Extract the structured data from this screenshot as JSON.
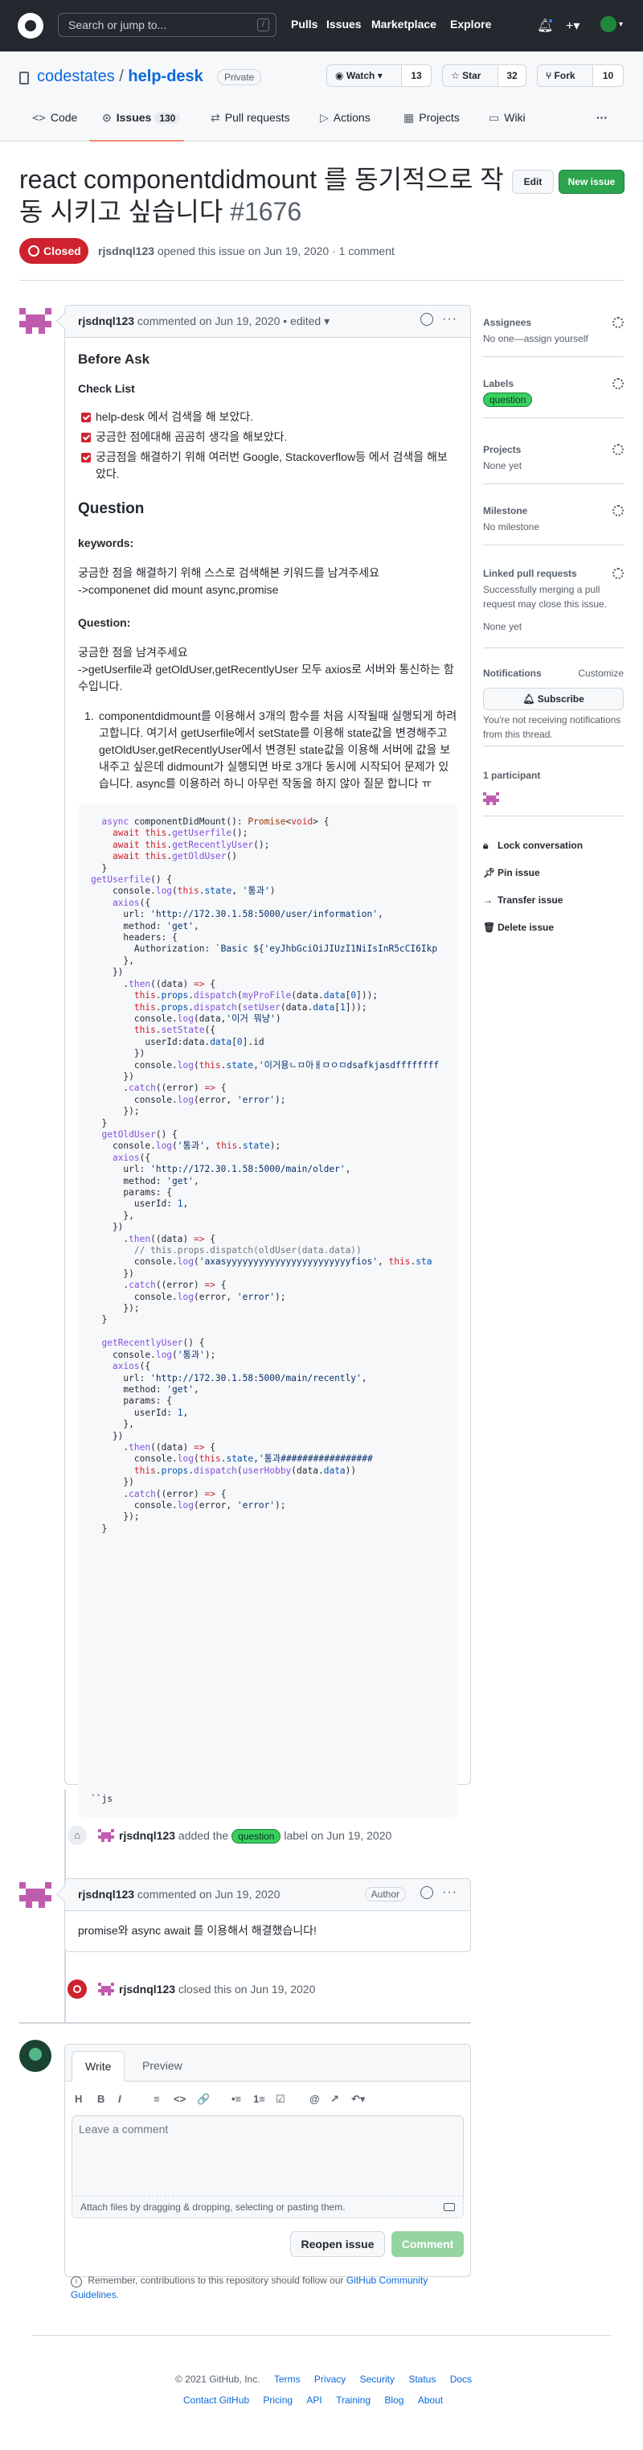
{
  "header": {
    "search_placeholder": "Search or jump to...",
    "search_key": "/",
    "nav": [
      "Pulls",
      "Issues",
      "Marketplace",
      "Explore"
    ]
  },
  "repo": {
    "owner": "codestates",
    "separator": "/",
    "name": "help-desk",
    "visibility": "Private",
    "watch_label": "Watch",
    "watch_count": "13",
    "star_label": "Star",
    "star_count": "32",
    "fork_label": "Fork",
    "fork_count": "10",
    "tabs": [
      {
        "label": "Code",
        "icon": "code-icon"
      },
      {
        "label": "Issues",
        "icon": "issue-opened-icon",
        "count": "130"
      },
      {
        "label": "Pull requests",
        "icon": "git-pull-request-icon"
      },
      {
        "label": "Actions",
        "icon": "play-icon"
      },
      {
        "label": "Projects",
        "icon": "table-icon"
      },
      {
        "label": "Wiki",
        "icon": "book-icon"
      }
    ],
    "more": "···"
  },
  "issue": {
    "title": "react componentdidmount 를 동기적으로 작동 시키고 싶습니다",
    "number": "#1676",
    "edit_label": "Edit",
    "new_issue_label": "New issue",
    "state": "Closed",
    "author": "rjsdnql123",
    "meta": "opened this issue on Jun 19, 2020 · 1 comment"
  },
  "first_comment": {
    "author": "rjsdnql123",
    "meta": "commented on Jun 19, 2020 • edited ▾",
    "before_ask": "Before Ask",
    "check_list": "Check List",
    "checks": [
      "help-desk 에서 검색을 해 보았다.",
      "궁금한 점에대해 곰곰히 생각을 해보았다.",
      "궁금점을 해결하기 위해 여러번 Google, Stackoverflow등 에서 검색을 해보았다."
    ],
    "question_heading": "Question",
    "keywords_label": "keywords:",
    "keywords_line1": "궁금한 점을 해결하기 위해 스스로 검색해본 키워드를 남겨주세요",
    "keywords_line2": "->componenet did mount async,promise",
    "question_label": "Question:",
    "question_line1": "궁금한 점을 남겨주세요",
    "question_line2": "->getUserfile과 getOldUser,getRecentlyUser 모두 axios로 서버와 통신하는 함수입니다.",
    "list_item": "componentdidmount를 이용해서 3개의 함수를 처음 시작될때 실행되게 하려고합니다. 여기서 getUserfile에서 setState를 이용해 state값을 변경해주고 getOldUser,getRecentlyUser에서 변경된 state값을 이용해 서버에 값을 보내주고 싶은데 didmount가 실행되면 바로 3개다 동시에 시작되어 문제가 있습니다. async를 이용하러 하니 아무런 작동을 하지 않아 질문 합니다 ㅠ",
    "code_tail": "``js"
  },
  "labeled_event": {
    "author": "rjsdnql123",
    "pre": "added the",
    "label": "question",
    "post": "label on Jun 19, 2020"
  },
  "second_comment": {
    "author": "rjsdnql123",
    "meta": "commented on Jun 19, 2020",
    "author_badge": "Author",
    "body": "promise와 async await 를 이용해서 해결했습니다!"
  },
  "closed_event": {
    "author": "rjsdnql123",
    "text": "closed this on Jun 19, 2020"
  },
  "composer": {
    "tab_write": "Write",
    "tab_preview": "Preview",
    "placeholder": "Leave a comment",
    "attach": "Attach files by dragging & dropping, selecting or pasting them.",
    "reopen": "Reopen issue",
    "comment": "Comment",
    "tools": [
      "H",
      "B",
      "I",
      "≡",
      "<>",
      "🔗",
      "•≡",
      "1≡",
      "☑",
      "@",
      "↗",
      "↶▾"
    ]
  },
  "remember": {
    "text": "Remember, contributions to this repository should follow our",
    "link": "GitHub Community Guidelines",
    "end": "."
  },
  "sidebar": {
    "assignees_heading": "Assignees",
    "assignees_value": "No one—assign yourself",
    "labels_heading": "Labels",
    "label": "question",
    "projects_heading": "Projects",
    "projects_value": "None yet",
    "milestone_heading": "Milestone",
    "milestone_value": "No milestone",
    "linked_heading": "Linked pull requests",
    "linked_text": "Successfully merging a pull request may close this issue.",
    "linked_value": "None yet",
    "notifications_heading": "Notifications",
    "customize": "Customize",
    "subscribe": "Subscribe",
    "notif_text": "You're not receiving notifications from this thread.",
    "participants": "1 participant",
    "lock": "Lock conversation",
    "pin": "Pin issue",
    "transfer": "Transfer issue",
    "delete": "Delete issue"
  },
  "footer": {
    "copyright": "© 2021 GitHub, Inc.",
    "links_row1": [
      "Terms",
      "Privacy",
      "Security",
      "Status",
      "Docs"
    ],
    "links_row2": [
      "Contact GitHub",
      "Pricing",
      "API",
      "Training",
      "Blog",
      "About"
    ]
  },
  "colors": {
    "accent": "#0969da",
    "closed": "#cf222e",
    "label": "#38d05f",
    "header": "#24292f"
  }
}
